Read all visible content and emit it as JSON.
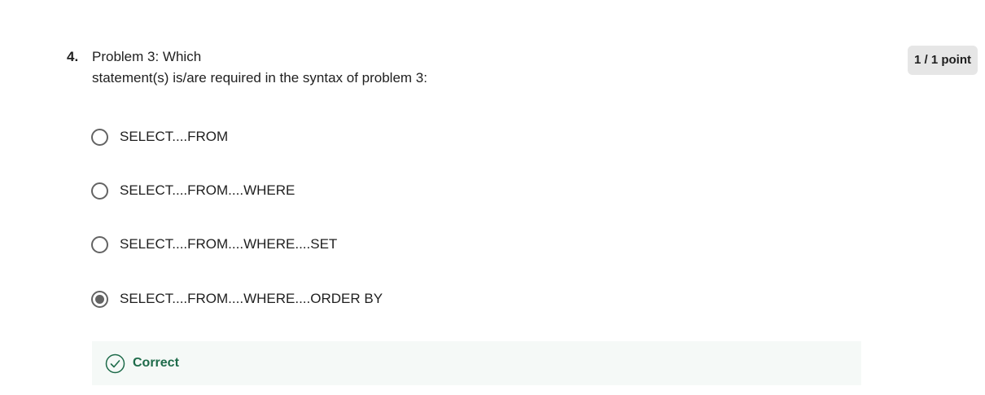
{
  "question": {
    "number": "4.",
    "text_line1": "Problem 3: Which",
    "text_line2": "statement(s) is/are required in the syntax of problem 3:",
    "points": "1 / 1 point"
  },
  "options": [
    {
      "label": "SELECT....FROM",
      "selected": false
    },
    {
      "label": "SELECT....FROM....WHERE",
      "selected": false
    },
    {
      "label": "SELECT....FROM....WHERE....SET",
      "selected": false
    },
    {
      "label": "SELECT....FROM....WHERE....ORDER BY",
      "selected": true
    }
  ],
  "feedback": {
    "status": "Correct",
    "icon": "check-circle-icon",
    "color": "#1e6b4a"
  },
  "colors": {
    "radio": "#636363",
    "feedback_bg": "#f5f9f7",
    "badge_bg": "#e6e6e6"
  }
}
